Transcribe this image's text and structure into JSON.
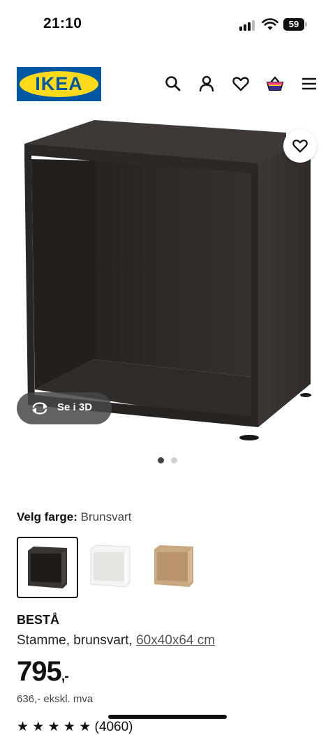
{
  "status_bar": {
    "time": "21:10",
    "battery": "59"
  },
  "header": {
    "logo_text": "IKEA",
    "icons": [
      "search-icon",
      "profile-icon",
      "heart-icon",
      "basket-icon",
      "menu-icon"
    ],
    "colors": {
      "brand_blue": "#0058a3",
      "brand_yellow": "#ffda1a"
    }
  },
  "gallery": {
    "view_3d_label": "Se i 3D",
    "image_count": 2,
    "active_image": 1
  },
  "product": {
    "color_label": "Velg farge:",
    "color_value": "Brunsvart",
    "swatches": [
      {
        "name": "Brunsvart",
        "color": "#3a3532",
        "selected": true
      },
      {
        "name": "Hvit",
        "color": "#f4f4f2",
        "selected": false
      },
      {
        "name": "Hvitbeiset eikemønstret",
        "color": "#c9a882",
        "selected": false
      }
    ],
    "name": "BESTÅ",
    "description": "Stamme, brunsvart, ",
    "dimensions": "60x40x64 cm",
    "price_main": "795",
    "price_suffix": ",-",
    "price_ex_vat": "636,- ekskl. mva",
    "rating_text": "★ ★ ★ ★ ★  (4060)"
  }
}
